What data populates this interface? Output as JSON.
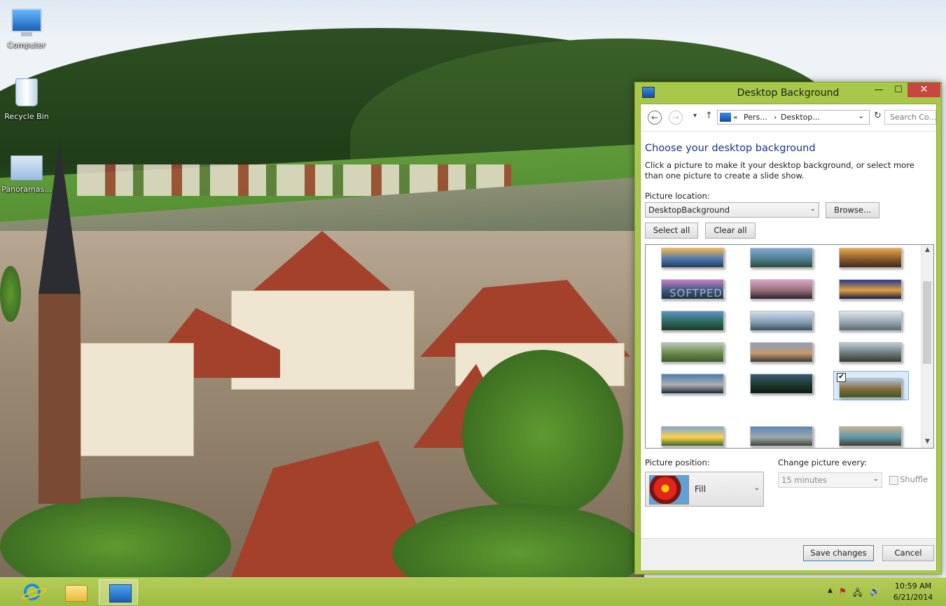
{
  "desktop": {
    "icons": [
      {
        "label": "Computer",
        "icon": "computer-icon"
      },
      {
        "label": "Recycle Bin",
        "icon": "recycle-bin-icon"
      },
      {
        "label": "Panoramas...",
        "icon": "panoramas-icon"
      }
    ],
    "watermark": "SOFTPEDIA"
  },
  "window": {
    "title": "Desktop Background",
    "controls": {
      "minimize": "—",
      "maximize": "☐",
      "close": "✕"
    },
    "nav": {
      "back": "←",
      "forward": "→",
      "recent": "▾",
      "up": "↑",
      "breadcrumb_prefix": "«",
      "breadcrumb": [
        "Pers...",
        "Desktop..."
      ],
      "breadcrumb_sep": "›",
      "dropdown": "⌄",
      "refresh": "↻",
      "search_placeholder": "Search Co..."
    },
    "heading": "Choose your desktop background",
    "description": "Click a picture to make it your desktop background, or select more than one picture to create a slide show.",
    "picture_location": {
      "label": "Picture location:",
      "value": "DesktopBackground",
      "browse_label": "Browse..."
    },
    "select_all_label": "Select all",
    "clear_all_label": "Clear all",
    "gallery": {
      "selected_index": 14,
      "check_mark": "✔",
      "thumbnails": [
        [
          "#f7b64a",
          "#4a79b5",
          "#2b3a4f"
        ],
        [
          "#7fa8cc",
          "#507f94",
          "#2a4a38"
        ],
        [
          "#e8a94a",
          "#8a5b2c",
          "#3a2b20"
        ],
        [
          "#c37ec4",
          "#3b5a7f",
          "#203040"
        ],
        [
          "#d7a6c8",
          "#9a6e7a",
          "#2a2030"
        ],
        [
          "#2a3a8a",
          "#e0a040",
          "#1a1a40"
        ],
        [
          "#5d94c8",
          "#2f6a5a",
          "#1c3a2c"
        ],
        [
          "#cfe0ec",
          "#8aa0b8",
          "#3a5060"
        ],
        [
          "#dde7ef",
          "#9aa9b2",
          "#5a6a70"
        ],
        [
          "#b8c8b8",
          "#6a8a4a",
          "#3a5a2a"
        ],
        [
          "#8aa0c0",
          "#c89a6a",
          "#3a3a3a"
        ],
        [
          "#bcccd8",
          "#6a7a7a",
          "#3a3a30"
        ],
        [
          "#4a7ab0",
          "#b0b0b0",
          "#1a2a3a"
        ],
        [
          "#3a5a7a",
          "#1a3a2a",
          "#0e1a14"
        ],
        [
          "#a9c7e0",
          "#8a6a3a",
          "#3a5a2a"
        ],
        [
          "#7aa8d8",
          "#ffd24a",
          "#3a6a2a"
        ],
        [
          "#5a88c0",
          "#a0a8a8",
          "#3a4a3a"
        ],
        [
          "#c8b088",
          "#5a9ab0",
          "#4a3a28"
        ]
      ],
      "scroll_up": "▲",
      "scroll_down": "▼"
    },
    "picture_position": {
      "label": "Picture position:",
      "value": "Fill",
      "chevron": "⌄"
    },
    "change_picture": {
      "label": "Change picture every:",
      "value": "15 minutes",
      "chevron": "⌄"
    },
    "shuffle_label": "Shuffle",
    "save_label": "Save changes",
    "cancel_label": "Cancel"
  },
  "taskbar": {
    "tray": {
      "chevron": "▲",
      "flag": "⚑",
      "network": "🖧",
      "volume": "🔊"
    },
    "time": "10:59 AM",
    "date": "6/21/2014"
  },
  "colors": {
    "window_border": "#a8c84a",
    "taskbar": "#a8c44c",
    "heading": "#1e3287",
    "close_button": "#c7463f"
  }
}
